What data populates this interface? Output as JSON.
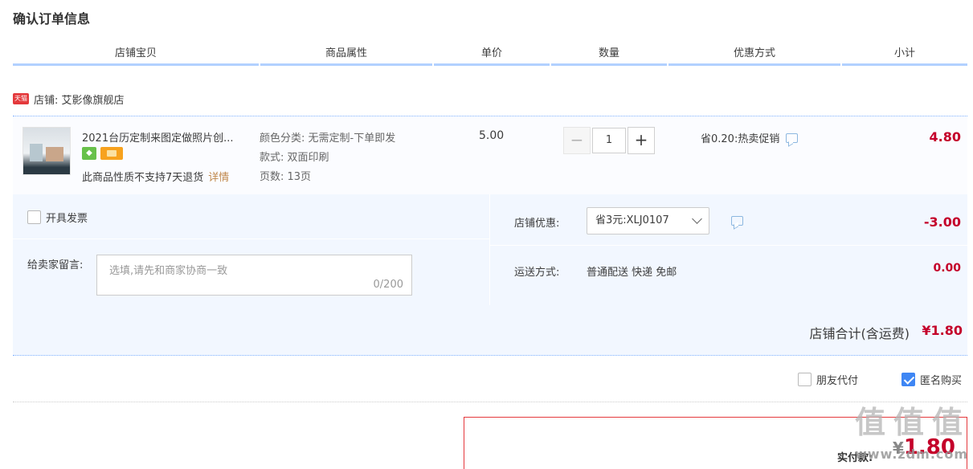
{
  "page": {
    "title": "确认订单信息"
  },
  "columns": [
    "店铺宝贝",
    "商品属性",
    "单价",
    "数量",
    "优惠方式",
    "小计"
  ],
  "shop": {
    "badge": "天猫",
    "name": "店铺: 艾影像旗舰店"
  },
  "item": {
    "name": "2021台历定制来图定做照片创...",
    "badge_icon": "tmall-service-icon",
    "no_return": "此商品性质不支持7天退货",
    "detail_link": "详情",
    "attributes": [
      "颜色分类: 无需定制-下单即发",
      "款式: 双面印刷",
      "页数: 13页"
    ],
    "price": "5.00",
    "quantity": "1",
    "quantity_minus": "−",
    "quantity_plus": "+",
    "promotion": "省0.20:热卖促销",
    "subtotal": "4.80"
  },
  "options": {
    "invoice_label": "开具发票",
    "message_label": "给卖家留言:",
    "message_placeholder": "选填,请先和商家协商一致",
    "message_count": "0/200",
    "shop_discount_label": "店铺优惠:",
    "shop_discount_selected": "省3元:XLJ0107",
    "shop_discount_value": "-3.00",
    "shipping_label": "运送方式:",
    "shipping_method": "普通配送 快递 免邮",
    "shipping_price": "0.00"
  },
  "shop_total": {
    "label": "店铺合计(含运费)",
    "value": "¥1.80"
  },
  "checkout_options": {
    "friend_pay": {
      "label": "朋友代付",
      "checked": false
    },
    "anonymous": {
      "label": "匿名购买",
      "checked": true
    }
  },
  "payment": {
    "label": "实付款:",
    "currency": "¥",
    "amount": "1.80"
  },
  "watermark": {
    "chars": [
      "值",
      "值",
      "值"
    ],
    "site": "www.zdm.com"
  },
  "colors": {
    "accent_red": "#c4002a",
    "header_line": "#b2d1ff",
    "panel_bg": "#f2f7ff",
    "checkbox_blue": "#3e86f4"
  }
}
